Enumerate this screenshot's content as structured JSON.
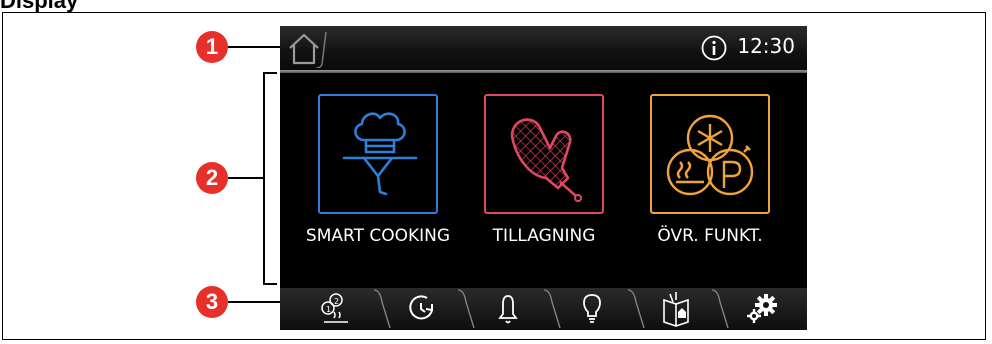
{
  "page": {
    "heading": "Display"
  },
  "topbar": {
    "time": "12:30",
    "home_icon": "home-icon",
    "info_icon": "info-icon"
  },
  "tiles": [
    {
      "label": "SMART COOKING",
      "color": "#2f7fd8",
      "icon": "chef-hat-tray-icon"
    },
    {
      "label": "TILLAGNING",
      "color": "#e0485f",
      "icon": "oven-mitt-icon"
    },
    {
      "label": "ÖVR. FUNKT.",
      "color": "#f0a33a",
      "icon": "other-functions-icon"
    }
  ],
  "bottom_tabs": [
    {
      "icon": "recipe-steps-icon"
    },
    {
      "icon": "timer-icon"
    },
    {
      "icon": "bell-icon"
    },
    {
      "icon": "lightbulb-icon"
    },
    {
      "icon": "cookbook-icon"
    },
    {
      "icon": "settings-gears-icon"
    }
  ],
  "callouts": [
    "1",
    "2",
    "3"
  ],
  "colors": {
    "callout": "#e8302b",
    "screen_bg": "#000000",
    "text": "#ffffff"
  }
}
